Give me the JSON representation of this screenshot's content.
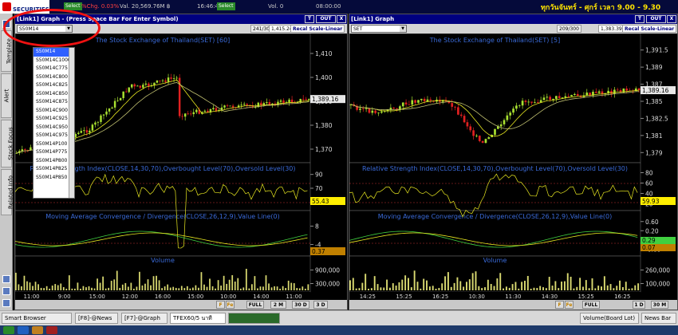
{
  "topbar": {
    "logo_text": "SECURITIES",
    "ticker_items": [
      {
        "label": "Select",
        "type": "button"
      },
      {
        "label": "%Chg. 0.03%",
        "color": "#ff4040"
      },
      {
        "label": "Val. 20,569.76M ฿",
        "color": "#ccc"
      },
      {
        "label": "16:46:44",
        "color": "#ccc"
      },
      {
        "label": "Select",
        "type": "button"
      },
      {
        "label": "Vol. 0",
        "color": "#ccc"
      },
      {
        "label": "08:00:00",
        "color": "#ccc"
      }
    ],
    "marquee": "ทุกวันจันทร์ - ศุกร์ เวลา 9.00 - 9.30"
  },
  "left_tabs": [
    "Template",
    "Alert",
    "Stock Focus",
    "Related Info"
  ],
  "panel_left": {
    "title": "[Link1] Graph - (Press Space Bar For Enter Symbol)",
    "btn_t": "T",
    "btn_out": "OUT",
    "btn_x": "X",
    "symbol": "S50M14",
    "count": "241/300",
    "last_price": "1,415.24",
    "recal": "Recal Scale-Linear",
    "chart_title": "The Stock Exchange of Thailand(SET) [60]",
    "price_ticks": [
      "1,410",
      "1,400",
      "1,390",
      "1,380",
      "1,370"
    ],
    "price_label": "1,389.16",
    "rsi_title": "Relative Strength Index(CLOSE,14,30,70),Overbought Level(70),Oversold Level(30)",
    "rsi_ticks": [
      "90",
      "70",
      "33"
    ],
    "rsi_label": "55.43",
    "macd_title": "Moving Average Convergence / Divergence(CLOSE,26,12,9),Value Line(0)",
    "macd_ticks": [
      "8",
      "-4"
    ],
    "macd_label": "0.37",
    "vol_title": "Volume",
    "vol_ticks": [
      "900,000",
      "300,000"
    ],
    "time_labels": [
      "11:00",
      "9:00",
      "15:00",
      "12:00",
      "16:00",
      "15:00",
      "10:00",
      "14:00",
      "11:00"
    ],
    "date_labels": [
      "25",
      "26",
      "27",
      "28",
      "31",
      "Apr",
      "2",
      "3",
      "4",
      "7",
      "8",
      "9",
      "10",
      "11"
    ],
    "dropdown": [
      "S50M14",
      "S50M14C1000",
      "S50M14C775",
      "S50M14C800",
      "S50M14C825",
      "S50M14C850",
      "S50M14C875",
      "S50M14C900",
      "S50M14C925",
      "S50M14C950",
      "S50M14C975",
      "S50M14P100",
      "S50M14P775",
      "S50M14P800",
      "S50M14P825",
      "S50M14P850"
    ],
    "bottom_buttons": [
      "F",
      "Fe",
      "FULL",
      "2 M",
      "30 D",
      "3 D"
    ]
  },
  "panel_right": {
    "title": "[Link1] Graph",
    "btn_t": "T",
    "btn_out": "OUT",
    "btn_x": "X",
    "symbol": "SET",
    "count": "209/300",
    "last_price": "1,383.39",
    "recal": "Recal Scale-Linear",
    "chart_title": "The Stock Exchange of Thailand(SET) [5]",
    "price_ticks": [
      "1,391.5",
      "1,389",
      "1,387",
      "1,385",
      "1,382.5",
      "1,381",
      "1,379"
    ],
    "price_label": "1,389.16",
    "rsi_title": "Relative Strength Index(CLOSE,14,30,70),Overbought Level(70),Oversold Level(30)",
    "rsi_ticks": [
      "80",
      "60",
      "40",
      "20"
    ],
    "rsi_label": "59.93",
    "macd_title": "Moving Average Convergence / Divergence(CLOSE,26,12,9),Value Line(0)",
    "macd_ticks": [
      "0.60",
      "0.20",
      "-0.20",
      "-0.60"
    ],
    "macd_label1": "0.29",
    "macd_label2": "0.07",
    "vol_title": "Volume",
    "vol_ticks": [
      "260,000",
      "100,000"
    ],
    "time_labels": [
      "14:25",
      "15:25",
      "16:25",
      "10:30",
      "11:30",
      "14:30",
      "15:25",
      "16:25"
    ],
    "date_labels": [
      "11"
    ],
    "bottom_buttons": [
      "F",
      "Fe",
      "FULL",
      "1 D",
      "30 M"
    ]
  },
  "taskbar": [
    "Smart Browser",
    "[F8]-@News",
    "[F7]-@Graph",
    "TFEX60/5 นาที",
    "Volume(Board Lot)",
    "News Bar"
  ],
  "colors": {
    "up": "#a8e030",
    "down": "#e02020",
    "ma": "#e8e820",
    "accent": "#000080"
  }
}
